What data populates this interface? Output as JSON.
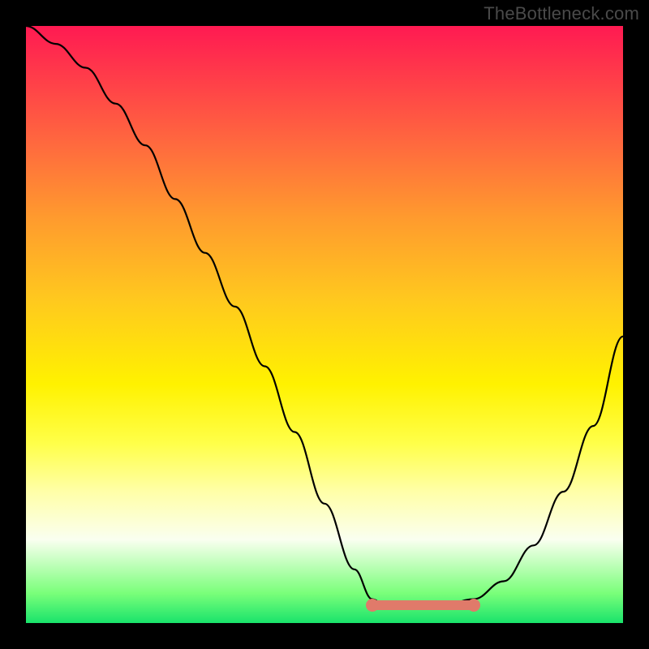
{
  "watermark": "TheBottleneck.com",
  "chart_data": {
    "type": "line",
    "title": "",
    "xlabel": "",
    "ylabel": "",
    "xlim": [
      0,
      1
    ],
    "ylim": [
      0,
      1
    ],
    "x": [
      0.0,
      0.05,
      0.1,
      0.15,
      0.2,
      0.25,
      0.3,
      0.35,
      0.4,
      0.45,
      0.5,
      0.55,
      0.58,
      0.6,
      0.65,
      0.7,
      0.75,
      0.8,
      0.85,
      0.9,
      0.95,
      1.0
    ],
    "values": [
      1.0,
      0.97,
      0.93,
      0.87,
      0.8,
      0.71,
      0.62,
      0.53,
      0.43,
      0.32,
      0.2,
      0.09,
      0.04,
      0.03,
      0.03,
      0.03,
      0.04,
      0.07,
      0.13,
      0.22,
      0.33,
      0.48
    ],
    "highlight": {
      "x_range": [
        0.58,
        0.75
      ],
      "y": 0.03
    },
    "colors": {
      "gradient_top": "#ff1a52",
      "gradient_mid": "#fff200",
      "gradient_bottom": "#19e36b",
      "curve": "#000000",
      "marker": "#e07a6a",
      "background_border": "#000000"
    }
  }
}
